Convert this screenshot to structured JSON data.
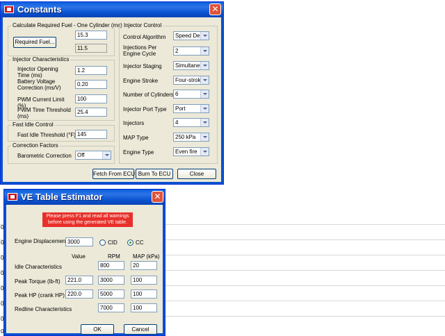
{
  "constants": {
    "title": "Constants",
    "req_fuel": {
      "group": "Calculate Required Fuel - One Cylinder (ms)",
      "button": "Required Fuel...",
      "value1": "15.3",
      "value2": "11.5"
    },
    "injector_char": {
      "group": "Injector Characteristics",
      "rows": [
        {
          "label": "Injector Opening Time (ms)",
          "value": "1.2"
        },
        {
          "label": "Battery Voltage Correction (ms/V)",
          "value": "0.20"
        },
        {
          "label": "PWM Current Limit (%)",
          "value": "100"
        },
        {
          "label": "PWM Time Threshold (ms)",
          "value": "25.4"
        }
      ]
    },
    "fast_idle": {
      "group": "Fast Idle Control",
      "label": "Fast Idle Threshold (°F)",
      "value": "145"
    },
    "correction": {
      "group": "Correction Factors",
      "label": "Barometric Correction",
      "value": "Off"
    },
    "injector_control": {
      "group": "Injector Control",
      "rows": [
        {
          "label": "Control Algorithm",
          "value": "Speed Den"
        },
        {
          "label": "Injections Per Engine Cycle",
          "value": "2"
        },
        {
          "label": "Injector Staging",
          "value": "Simultaneo"
        },
        {
          "label": "Engine Stroke",
          "value": "Four-stroke"
        },
        {
          "label": "Number of Cylinders",
          "value": "6"
        },
        {
          "label": "Injector Port Type",
          "value": "Port"
        },
        {
          "label": "Injectors",
          "value": "4"
        },
        {
          "label": "MAP Type",
          "value": "250 kPa"
        },
        {
          "label": "Engine Type",
          "value": "Even fire"
        }
      ]
    },
    "buttons": {
      "fetch": "Fetch From ECU",
      "burn": "Burn To ECU",
      "close": "Close"
    }
  },
  "ve": {
    "title": "VE Table Estimator",
    "warning": "Please press F1 and read all warnings before using the generated VE table.",
    "displacement": {
      "label": "Engine Displacement",
      "value": "3000",
      "cid": "CID",
      "cc": "CC",
      "selected": "CC"
    },
    "headers": {
      "value": "Value",
      "rpm": "RPM",
      "map": "MAP (kPa)"
    },
    "rows": [
      {
        "label": "Idle Characteristics",
        "value": "",
        "rpm": "800",
        "map": "20"
      },
      {
        "label": "Peak Torque (lb-ft)",
        "value": "221.0",
        "rpm": "3000",
        "map": "100"
      },
      {
        "label": "Peak HP (crank HP)",
        "value": "220.0",
        "rpm": "5000",
        "map": "100"
      },
      {
        "label": "Redline Characteristics",
        "value": "",
        "rpm": "7000",
        "map": "100"
      }
    ],
    "buttons": {
      "ok": "OK",
      "cancel": "Cancel"
    }
  },
  "background": {
    "edge_numbers": [
      "0",
      "0",
      "0",
      "0",
      "0",
      "0",
      "0",
      "0"
    ]
  }
}
